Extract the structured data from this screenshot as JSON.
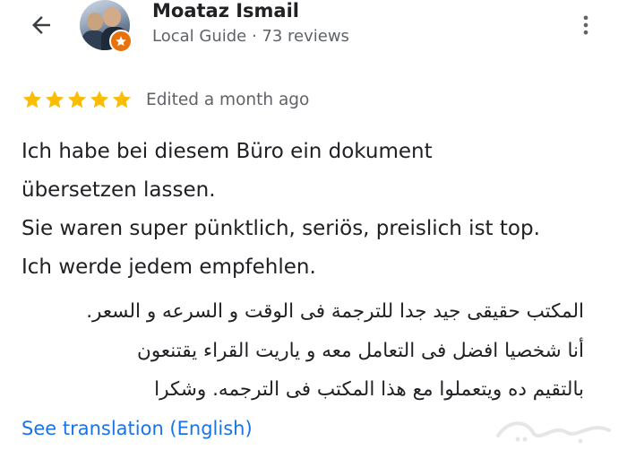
{
  "header": {
    "back_icon": "arrow-back-icon",
    "reviewer_name": "Moataz Ismail",
    "reviewer_meta": "Local Guide · 73 reviews",
    "badge_icon": "local-guide-star-icon",
    "more_icon": "more-vert-icon"
  },
  "review": {
    "rating": 5,
    "max_rating": 5,
    "star_color": "#fbbc04",
    "edited_label": "Edited a month ago",
    "text_lines": [
      "Ich habe bei diesem Büro ein dokument",
      "übersetzen lassen.",
      "Sie waren super pünktlich, seriös, preislich ist top.",
      "Ich werde jedem empfehlen."
    ],
    "arabic_lines": [
      "المكتب حقيقى جيد جدا للترجمة فى الوقت و السرعه و السعر.",
      "أنا شخصيا افضل فى التعامل معه و ياريت القراء يقتنعون",
      "بالتقيم ده ويتعملوا مع هذا المكتب فى الترجمه. وشكرا"
    ],
    "see_translation": "See translation (English)"
  },
  "colors": {
    "link": "#1a73e8",
    "badge": "#e8710a",
    "secondary_text": "#5f6368"
  }
}
